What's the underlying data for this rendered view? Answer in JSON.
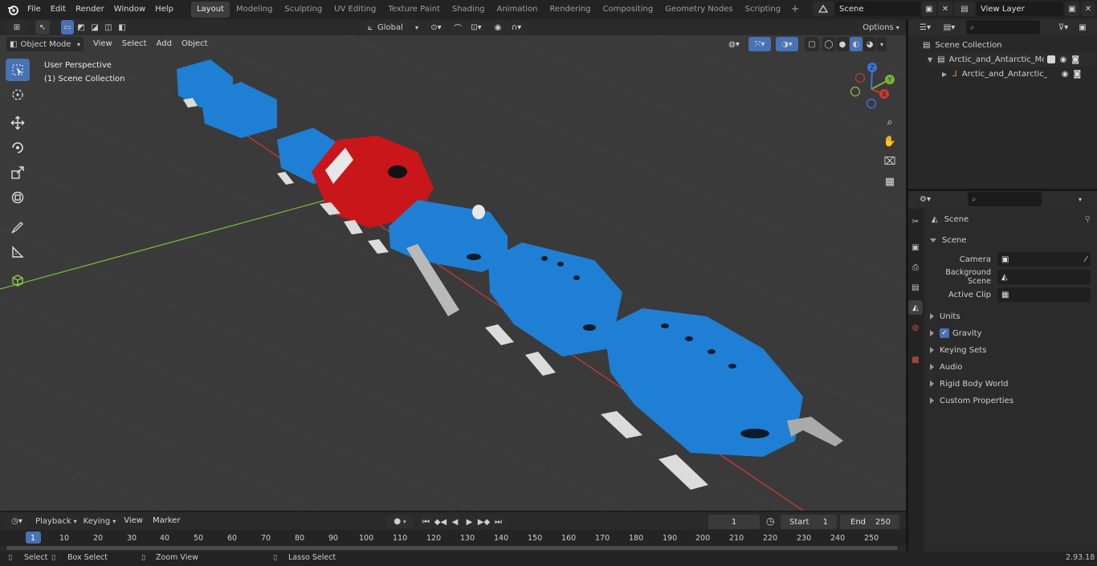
{
  "topbar": {
    "menus": [
      "File",
      "Edit",
      "Render",
      "Window",
      "Help"
    ],
    "workspaces": [
      "Layout",
      "Modeling",
      "Sculpting",
      "UV Editing",
      "Texture Paint",
      "Shading",
      "Animation",
      "Rendering",
      "Compositing",
      "Geometry Nodes",
      "Scripting"
    ],
    "active_workspace": "Layout",
    "scene_name": "Scene",
    "view_layer_name": "View Layer"
  },
  "viewport": {
    "mode": "Object Mode",
    "menus": [
      "View",
      "Select",
      "Add",
      "Object"
    ],
    "orientation": "Global",
    "options_label": "Options",
    "perspective_label": "User Perspective",
    "collection_label": "(1) Scene Collection",
    "gizmo_axes": {
      "x": "X",
      "y": "Y",
      "z": "Z"
    }
  },
  "outliner": {
    "search_placeholder": "",
    "root": "Scene Collection",
    "items": [
      {
        "label": "Arctic_and_Antarctic_Mobile_I"
      },
      {
        "label": "Arctic_and_Antarctic_Mot"
      }
    ]
  },
  "properties": {
    "context_label": "Scene",
    "section_title": "Scene",
    "fields": [
      {
        "label": "Camera",
        "value": ""
      },
      {
        "label": "Background Scene",
        "value": ""
      },
      {
        "label": "Active Clip",
        "value": ""
      }
    ],
    "panels": [
      {
        "label": "Units"
      },
      {
        "label": "Gravity",
        "checkbox": true
      },
      {
        "label": "Keying Sets"
      },
      {
        "label": "Audio"
      },
      {
        "label": "Rigid Body World"
      },
      {
        "label": "Custom Properties"
      }
    ]
  },
  "timeline": {
    "menus": [
      "Playback",
      "Keying",
      "View",
      "Marker"
    ],
    "current_frame": "1",
    "start_label": "Start",
    "start_value": "1",
    "end_label": "End",
    "end_value": "250",
    "ruler": [
      "1",
      "10",
      "20",
      "30",
      "40",
      "50",
      "60",
      "70",
      "80",
      "90",
      "100",
      "110",
      "120",
      "130",
      "140",
      "150",
      "160",
      "170",
      "180",
      "190",
      "200",
      "210",
      "220",
      "230",
      "240",
      "250"
    ]
  },
  "statusbar": {
    "select": "Select",
    "box_select": "Box Select",
    "zoom_view": "Zoom View",
    "lasso_select": "Lasso Select",
    "version": "2.93.18"
  },
  "colors": {
    "accent": "#4772b3",
    "module_blue": "#1f7fd4",
    "module_red": "#c8161b",
    "axis_x": "#c93a3a",
    "axis_y": "#7ab33a"
  }
}
